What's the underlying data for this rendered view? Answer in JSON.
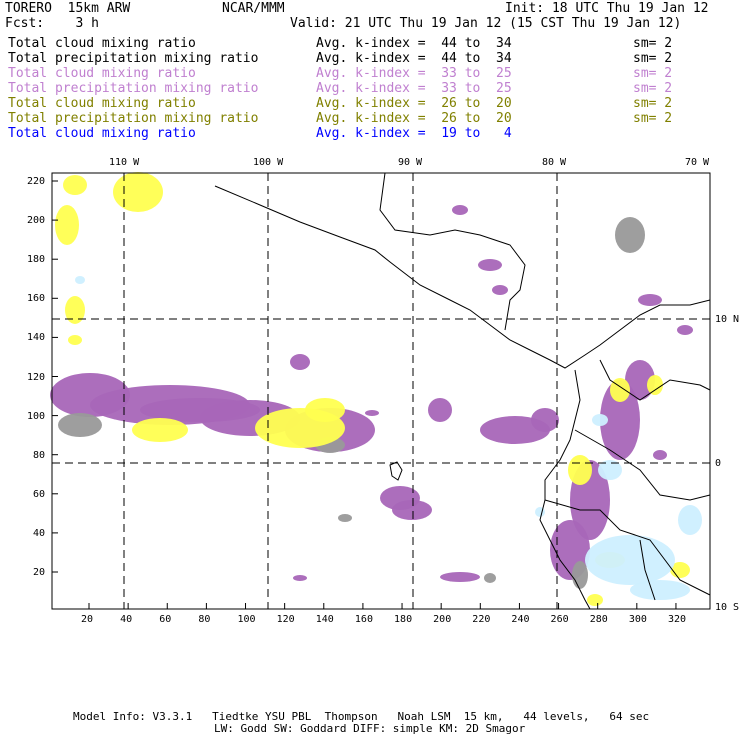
{
  "header": {
    "model": "TORERO  15km ARW",
    "org": "NCAR/MMM",
    "init": "Init: 18 UTC Thu 19 Jan 12",
    "fcst": "Fcst:    3 h",
    "valid": "Valid: 21 UTC Thu 19 Jan 12 (15 CST Thu 19 Jan 12)"
  },
  "legend": [
    {
      "field": "Total cloud mixing ratio",
      "kindex": "Avg. k-index =  44 to  34",
      "sm": "sm= 2",
      "color": "#000000"
    },
    {
      "field": "Total precipitation mixing ratio",
      "kindex": "Avg. k-index =  44 to  34",
      "sm": "sm= 2",
      "color": "#000000"
    },
    {
      "field": "Total cloud mixing ratio",
      "kindex": "Avg. k-index =  33 to  25",
      "sm": "sm= 2",
      "color": "#c080d0"
    },
    {
      "field": "Total precipitation mixing ratio",
      "kindex": "Avg. k-index =  33 to  25",
      "sm": "sm= 2",
      "color": "#c080d0"
    },
    {
      "field": "Total cloud mixing ratio",
      "kindex": "Avg. k-index =  26 to  20",
      "sm": "sm= 2",
      "color": "#808000"
    },
    {
      "field": "Total precipitation mixing ratio",
      "kindex": "Avg. k-index =  26 to  20",
      "sm": "sm= 2",
      "color": "#808000"
    },
    {
      "field": "Total cloud mixing ratio",
      "kindex": "Avg. k-index =  19 to   4",
      "sm": "",
      "color": "#0000ff"
    }
  ],
  "map": {
    "lon_labels": [
      "110 W",
      "100 W",
      "90 W",
      "80 W",
      "70 W"
    ],
    "lat_labels": [
      "10 N",
      "0",
      "10 S"
    ],
    "x_ticks": [
      "20",
      "40",
      "60",
      "80",
      "100",
      "120",
      "140",
      "160",
      "180",
      "200",
      "220",
      "240",
      "260",
      "280",
      "300",
      "320"
    ],
    "y_ticks": [
      "220",
      "200",
      "180",
      "160",
      "140",
      "120",
      "100",
      "80",
      "60",
      "40",
      "20"
    ],
    "colors": {
      "purple": "#a866b8",
      "yellow": "#ffff50",
      "gray": "#999999",
      "lightblue": "#cdefff"
    }
  },
  "footer": {
    "line1": "Model Info: V3.3.1   Tiedtke YSU PBL  Thompson   Noah LSM  15 km,   44 levels,   64 sec",
    "line2": "LW: Godd SW: Goddard DIFF: simple KM: 2D Smagor"
  }
}
